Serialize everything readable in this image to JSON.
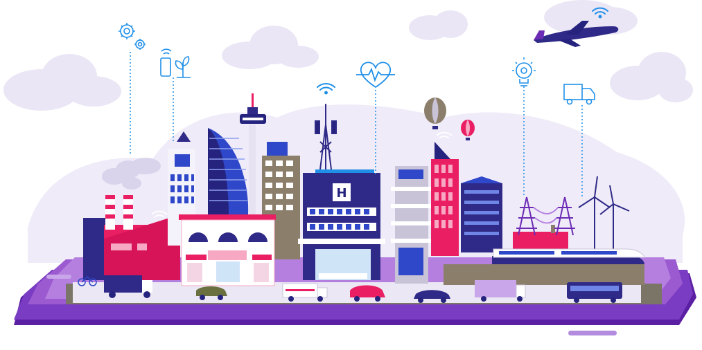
{
  "colors": {
    "purple_dark": "#3a1e7a",
    "purple_mid": "#6c2bb5",
    "purple_light": "#9b5ad0",
    "lilac_bg": "#ede9f8",
    "cloud": "#ebe6f5",
    "navy": "#25237e",
    "blue": "#2f48c9",
    "pink": "#e91e63",
    "pink_light": "#f7a9c4",
    "sky_icon": "#1f8fe8",
    "road": "#7a7566",
    "street": "#e9e6f2"
  },
  "icons": [
    "gears-icon",
    "phone-plant-icon",
    "wifi-icon",
    "heartbeat-icon",
    "lightbulb-gear-icon",
    "delivery-truck-icon",
    "airplane-icon"
  ],
  "hospital": {
    "sign": "H"
  }
}
